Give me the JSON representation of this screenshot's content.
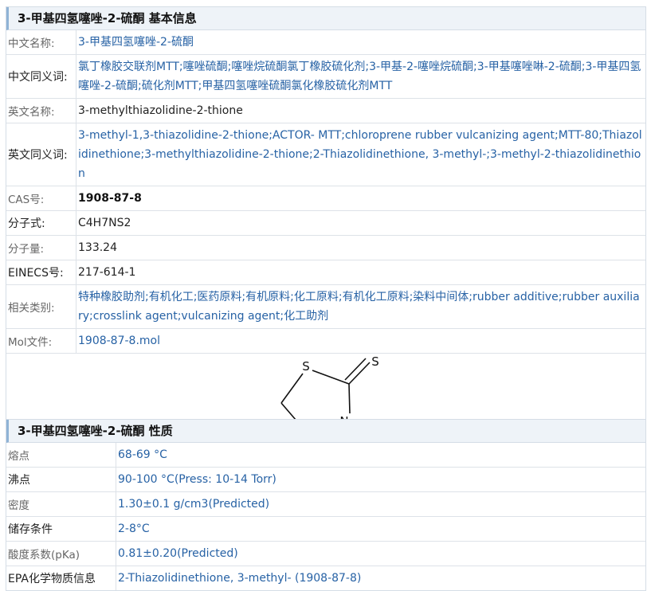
{
  "basic": {
    "title": "3-甲基四氢噻唑-2-硫酮 基本信息",
    "rows": {
      "cn_name": {
        "label": "中文名称:",
        "value": "3-甲基四氢噻唑-2-硫酮"
      },
      "cn_syn": {
        "label": "中文同义词:",
        "value": "氯丁橡胶交联剂MTT;噻唑硫酮;噻唑烷硫酮氯丁橡胶硫化剂;3-甲基-2-噻唑烷硫酮;3-甲基噻唑啉-2-硫酮;3-甲基四氢噻唑-2-硫酮;硫化剂MTT;甲基四氢噻唑硫酮氯化橡胶硫化剂MTT"
      },
      "en_name": {
        "label": "英文名称:",
        "value": "3-methylthiazolidine-2-thione"
      },
      "en_syn": {
        "label": "英文同义词:",
        "value": "3-methyl-1,3-thiazolidine-2-thione;ACTOR- MTT;chloroprene rubber vulcanizing agent;MTT-80;Thiazolidinethione;3-methylthiazolidine-2-thione;2-Thiazolidinethione, 3-methyl-;3-methyl-2-thiazolidinethion"
      },
      "cas": {
        "label": "CAS号:",
        "value": "1908-87-8"
      },
      "formula": {
        "label": "分子式:",
        "value": "C4H7NS2"
      },
      "mw": {
        "label": "分子量:",
        "value": "133.24"
      },
      "einecs": {
        "label": "EINECS号:",
        "value": "217-614-1"
      },
      "category": {
        "label": "相关类别:",
        "value": "特种橡胶助剂;有机化工;医药原料;有机原料;化工原料;有机化工原料;染料中间体;rubber additive;rubber auxiliary;crosslink agent;vulcanizing agent;化工助剂"
      },
      "mol": {
        "label": "Mol文件:",
        "value": "1908-87-8.mol"
      }
    },
    "structure": {
      "atom_s1": "S",
      "atom_s2": "S",
      "atom_n": "N"
    }
  },
  "props": {
    "title": "3-甲基四氢噻唑-2-硫酮 性质",
    "rows": {
      "mp": {
        "label": "熔点",
        "value": "68-69 °C"
      },
      "bp": {
        "label": "沸点",
        "value": "90-100 °C(Press: 10-14 Torr)"
      },
      "density": {
        "label": "密度",
        "value": "1.30±0.1 g/cm3(Predicted)"
      },
      "storage": {
        "label": "储存条件",
        "value": "2-8°C"
      },
      "pka": {
        "label": "酸度系数(pKa)",
        "value": "0.81±0.20(Predicted)"
      },
      "epa": {
        "label": "EPA化学物质信息",
        "value": "2-Thiazolidinethione, 3-methyl- (1908-87-8)"
      }
    }
  }
}
